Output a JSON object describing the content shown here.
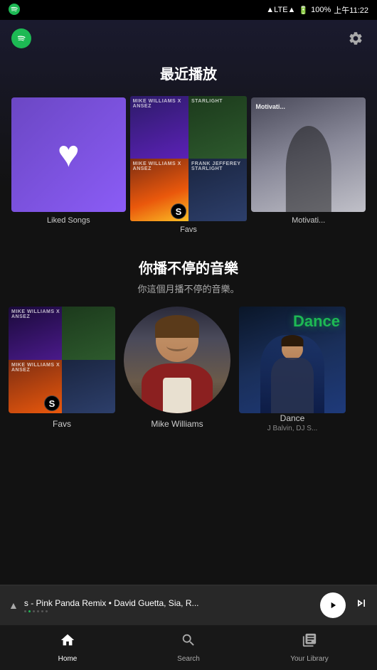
{
  "statusBar": {
    "time": "上午11:22",
    "carrier": "LTE",
    "battery": "100%"
  },
  "header": {
    "appName": "Spotify"
  },
  "recentSection": {
    "title": "最近播放",
    "items": [
      {
        "id": "liked-songs",
        "label": "Liked Songs"
      },
      {
        "id": "favs-top",
        "label": ""
      },
      {
        "id": "favs-bottom",
        "label": ""
      },
      {
        "id": "favs",
        "label": "Favs"
      },
      {
        "id": "motivation",
        "label": "Motivati..."
      }
    ]
  },
  "recommendSection": {
    "title": "你播不停的音樂",
    "subtitle": "你這個月播不停的音樂。",
    "items": [
      {
        "id": "favs-large",
        "label": "Favs",
        "type": "playlist"
      },
      {
        "id": "mike-williams",
        "label": "Mike Williams",
        "type": "artist"
      },
      {
        "id": "dance",
        "label": "Dance",
        "sublabel": "J Balvin, DJ S...",
        "type": "playlist"
      }
    ]
  },
  "nowPlaying": {
    "track": "s - Pink Panda Remix • David Guetta, Sia, R...",
    "currentPage": "2",
    "totalPages": "6",
    "pageIndicator": "2/6"
  },
  "bottomNav": {
    "home": {
      "label": "Home",
      "active": true
    },
    "search": {
      "label": "Search",
      "active": false
    },
    "library": {
      "label": "Your Library",
      "active": false
    }
  },
  "settings": {
    "label": "Settings"
  }
}
